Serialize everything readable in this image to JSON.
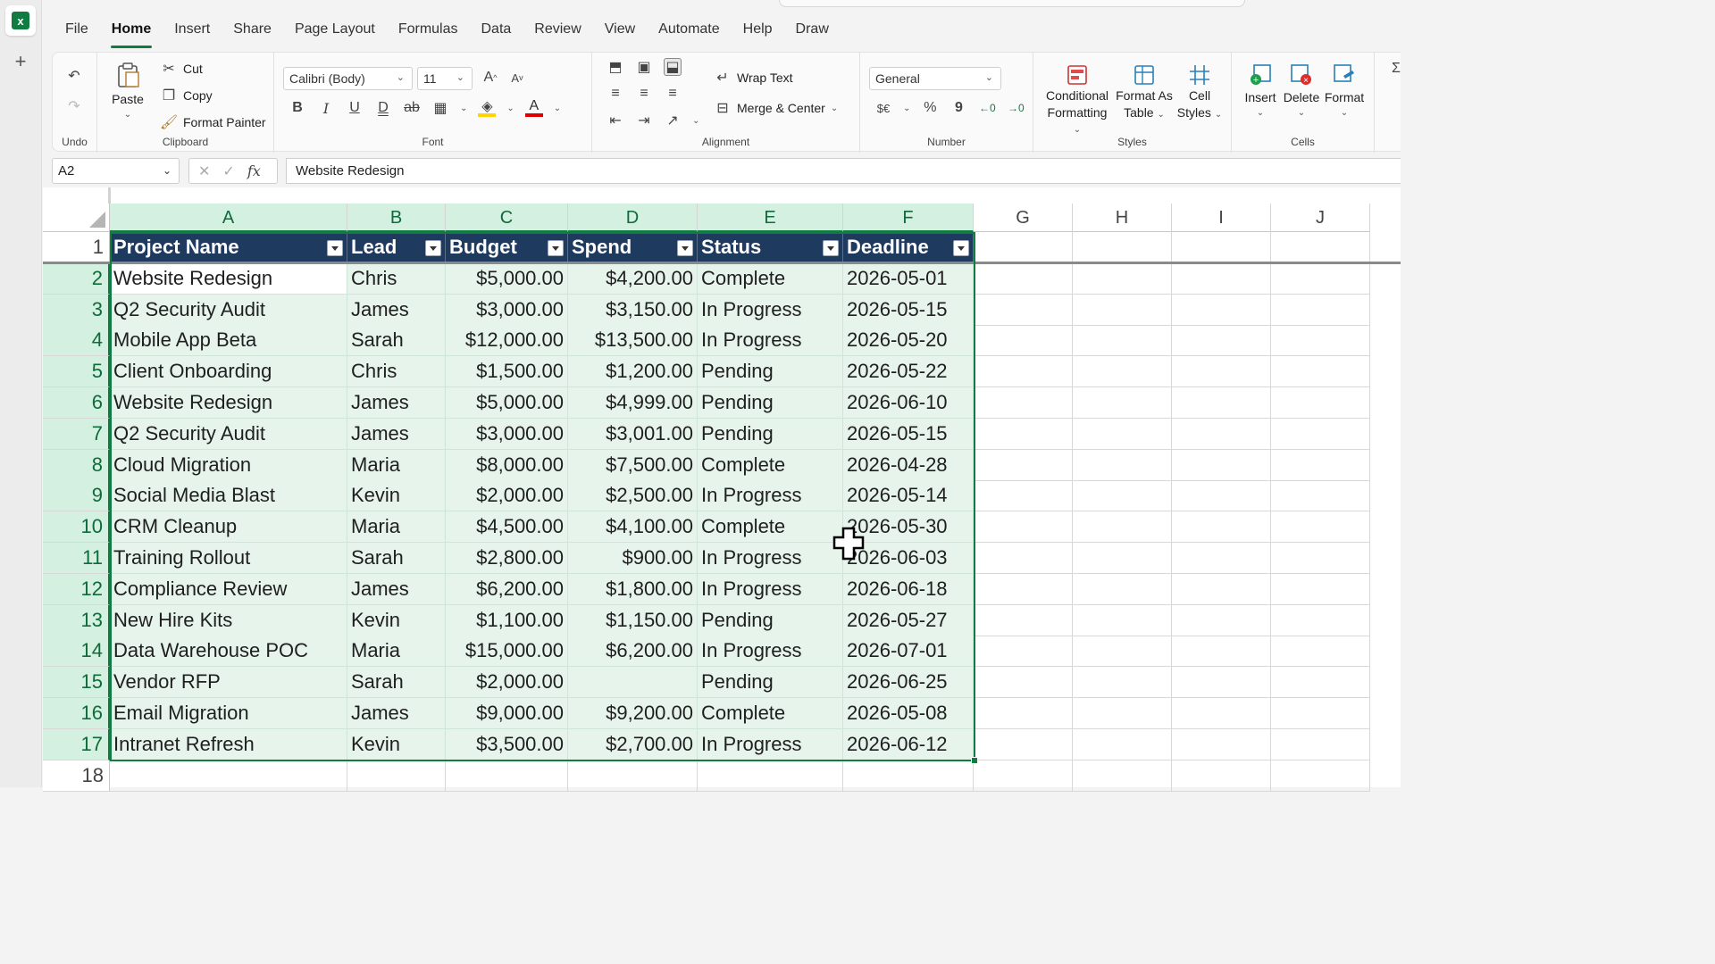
{
  "menu": [
    "File",
    "Home",
    "Insert",
    "Share",
    "Page Layout",
    "Formulas",
    "Data",
    "Review",
    "View",
    "Automate",
    "Help",
    "Draw"
  ],
  "menu_active": "Home",
  "ribbon": {
    "undo_group": "Undo",
    "clipboard": {
      "paste": "Paste",
      "cut": "Cut",
      "copy": "Copy",
      "format_painter": "Format Painter",
      "label": "Clipboard"
    },
    "font": {
      "name": "Calibri (Body)",
      "size": "11",
      "label": "Font",
      "bold": "B",
      "italic": "I",
      "underline": "U",
      "double_underline": "D"
    },
    "alignment": {
      "wrap": "Wrap Text",
      "merge": "Merge & Center",
      "label": "Alignment"
    },
    "number": {
      "format": "General",
      "label": "Number",
      "currency": "$€",
      "percent": "%",
      "comma": "9"
    },
    "styles": {
      "conditional": [
        "Conditional",
        "Formatting"
      ],
      "format_table": [
        "Format As",
        "Table"
      ],
      "cell_styles": [
        "Cell",
        "Styles"
      ],
      "label": "Styles"
    },
    "cells": {
      "insert": "Insert",
      "delete": "Delete",
      "format": "Format",
      "label": "Cells"
    }
  },
  "formula_bar": {
    "name_box": "A2",
    "fx": "fx",
    "value": "Website Redesign"
  },
  "columns": [
    "A",
    "B",
    "C",
    "D",
    "E",
    "F",
    "G",
    "H",
    "I",
    "J"
  ],
  "selected_columns": [
    "A",
    "B",
    "C",
    "D",
    "E",
    "F"
  ],
  "rows": [
    "1",
    "2",
    "3",
    "4",
    "5",
    "6",
    "7",
    "8",
    "9",
    "10",
    "11",
    "12",
    "13",
    "14",
    "15",
    "16",
    "17",
    "18"
  ],
  "table": {
    "headers": [
      "Project Name",
      "Lead",
      "Budget",
      "Spend",
      "Status",
      "Deadline"
    ],
    "rows": [
      [
        "Website Redesign",
        "Chris",
        "$5,000.00",
        "$4,200.00",
        "Complete",
        "2026-05-01"
      ],
      [
        "Q2 Security Audit",
        "James",
        "$3,000.00",
        "$3,150.00",
        "In Progress",
        "2026-05-15"
      ],
      [
        "Mobile App Beta",
        "Sarah",
        "$12,000.00",
        "$13,500.00",
        "In Progress",
        "2026-05-20"
      ],
      [
        "Client Onboarding",
        "Chris",
        "$1,500.00",
        "$1,200.00",
        "Pending",
        "2026-05-22"
      ],
      [
        "Website Redesign",
        "James",
        "$5,000.00",
        "$4,999.00",
        "Pending",
        "2026-06-10"
      ],
      [
        "Q2 Security Audit",
        "James",
        "$3,000.00",
        "$3,001.00",
        "Pending",
        "2026-05-15"
      ],
      [
        "Cloud Migration",
        "Maria",
        "$8,000.00",
        "$7,500.00",
        "Complete",
        "2026-04-28"
      ],
      [
        "Social Media Blast",
        "Kevin",
        "$2,000.00",
        "$2,500.00",
        "In Progress",
        "2026-05-14"
      ],
      [
        "CRM Cleanup",
        "Maria",
        "$4,500.00",
        "$4,100.00",
        "Complete",
        "2026-05-30"
      ],
      [
        "Training Rollout",
        "Sarah",
        "$2,800.00",
        "$900.00",
        "In Progress",
        "2026-06-03"
      ],
      [
        "Compliance Review",
        "James",
        "$6,200.00",
        "$1,800.00",
        "In Progress",
        "2026-06-18"
      ],
      [
        "New Hire Kits",
        "Kevin",
        "$1,100.00",
        "$1,150.00",
        "Pending",
        "2026-05-27"
      ],
      [
        "Data Warehouse POC",
        "Maria",
        "$15,000.00",
        "$6,200.00",
        "In Progress",
        "2026-07-01"
      ],
      [
        "Vendor RFP",
        "Sarah",
        "$2,000.00",
        "",
        "Pending",
        "2026-06-25"
      ],
      [
        "Email Migration",
        "James",
        "$9,000.00",
        "$9,200.00",
        "Complete",
        "2026-05-08"
      ],
      [
        "Intranet Refresh",
        "Kevin",
        "$3,500.00",
        "$2,700.00",
        "In Progress",
        "2026-06-12"
      ]
    ]
  },
  "colors": {
    "accent": "#107c41",
    "table_header": "#1f3a5f",
    "selection_fill": "#e6f4eb"
  }
}
